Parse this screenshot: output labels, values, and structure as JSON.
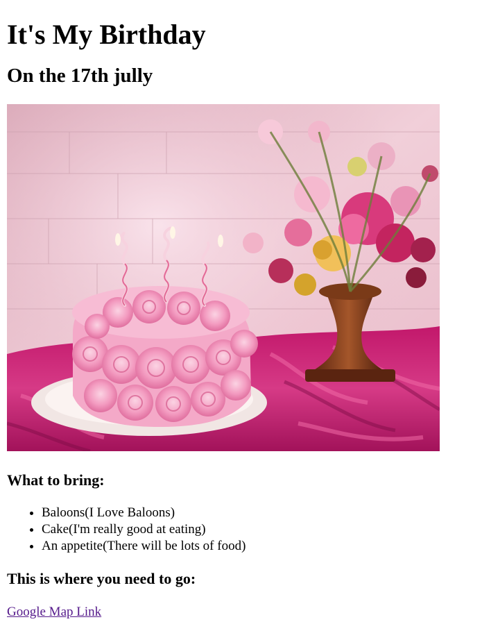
{
  "page": {
    "title": "It's My Birthday",
    "subtitle": "On the 17th jully"
  },
  "hero_image": {
    "depicts": "pink rose birthday cake with spiral candles beside a flower vase on magenta cloth"
  },
  "bring_section": {
    "heading": "What to bring:",
    "items": [
      "Baloons(I Love Baloons)",
      "Cake(I'm really good at eating)",
      "An appetite(There will be lots of food)"
    ]
  },
  "location_section": {
    "heading": "This is where you need to go:",
    "link_label": "Google Map Link"
  },
  "colors": {
    "link_visited": "#551a8b",
    "text": "#000000",
    "background": "#ffffff"
  }
}
